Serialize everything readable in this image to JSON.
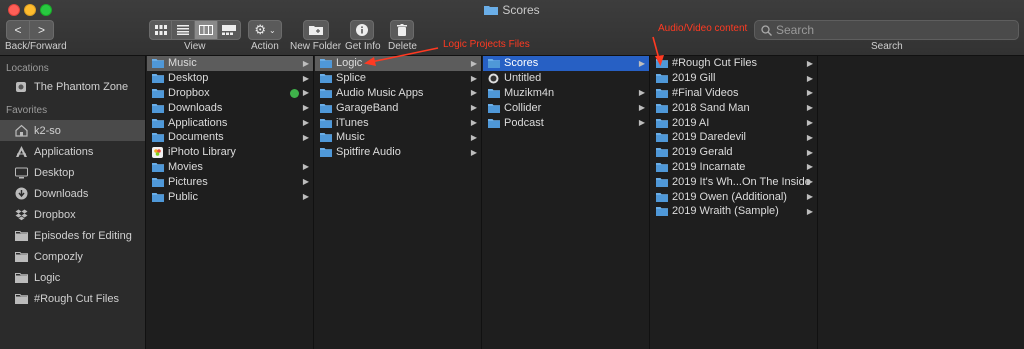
{
  "window": {
    "title": "Scores"
  },
  "toolbar": {
    "nav_back": "<",
    "nav_forward": ">",
    "nav_label": "Back/Forward",
    "view_label": "View",
    "action_label": "Action",
    "new_folder_label": "New Folder",
    "get_info_label": "Get Info",
    "delete_label": "Delete",
    "search_placeholder": "Search",
    "search_label": "Search"
  },
  "sidebar": {
    "locations_header": "Locations",
    "locations": [
      {
        "label": "The Phantom Zone",
        "icon": "drive-icon"
      }
    ],
    "favorites_header": "Favorites",
    "favorites": [
      {
        "label": "k2-so",
        "icon": "home-icon",
        "selected": true
      },
      {
        "label": "Applications",
        "icon": "applications-icon"
      },
      {
        "label": "Desktop",
        "icon": "desktop-icon"
      },
      {
        "label": "Downloads",
        "icon": "downloads-icon"
      },
      {
        "label": "Dropbox",
        "icon": "dropbox-icon"
      },
      {
        "label": "Episodes for Editing",
        "icon": "folder-icon"
      },
      {
        "label": "Compozly",
        "icon": "folder-icon"
      },
      {
        "label": "Logic",
        "icon": "folder-icon"
      },
      {
        "label": "#Rough Cut Files",
        "icon": "folder-icon"
      }
    ]
  },
  "columns": [
    {
      "items": [
        {
          "label": "Music",
          "selected": "gray"
        },
        {
          "label": "Desktop"
        },
        {
          "label": "Dropbox",
          "badge": true
        },
        {
          "label": "Downloads"
        },
        {
          "label": "Applications"
        },
        {
          "label": "Documents"
        },
        {
          "label": "iPhoto Library",
          "icon": "photo-library-icon",
          "noarrow": true
        },
        {
          "label": "Movies"
        },
        {
          "label": "Pictures"
        },
        {
          "label": "Public"
        }
      ]
    },
    {
      "items": [
        {
          "label": "Logic",
          "selected": "gray"
        },
        {
          "label": "Splice"
        },
        {
          "label": "Audio Music Apps"
        },
        {
          "label": "GarageBand"
        },
        {
          "label": "iTunes"
        },
        {
          "label": "Music"
        },
        {
          "label": "Spitfire Audio"
        }
      ]
    },
    {
      "items": [
        {
          "label": "Scores",
          "selected": "blue"
        },
        {
          "label": "Untitled",
          "icon": "logic-project-icon",
          "noarrow": true
        },
        {
          "label": "Muzikm4n"
        },
        {
          "label": "Collider"
        },
        {
          "label": "Podcast"
        }
      ]
    },
    {
      "items": [
        {
          "label": "#Rough Cut Files"
        },
        {
          "label": "2019 Gill"
        },
        {
          "label": "#Final Videos"
        },
        {
          "label": "2018 Sand Man"
        },
        {
          "label": "2019 AI"
        },
        {
          "label": "2019 Daredevil"
        },
        {
          "label": "2019 Gerald"
        },
        {
          "label": "2019 Incarnate"
        },
        {
          "label": "2019 It's Wh...On The Inside"
        },
        {
          "label": "2019 Owen (Additional)"
        },
        {
          "label": "2019 Wraith (Sample)"
        }
      ]
    }
  ],
  "annotations": {
    "logic_projects": "Logic Projects Files",
    "audio_video": "Audio/Video content",
    "color": "#ff3a22"
  },
  "colors": {
    "selection_blue": "#2760c4",
    "folder_blue": "#6aaee8"
  }
}
